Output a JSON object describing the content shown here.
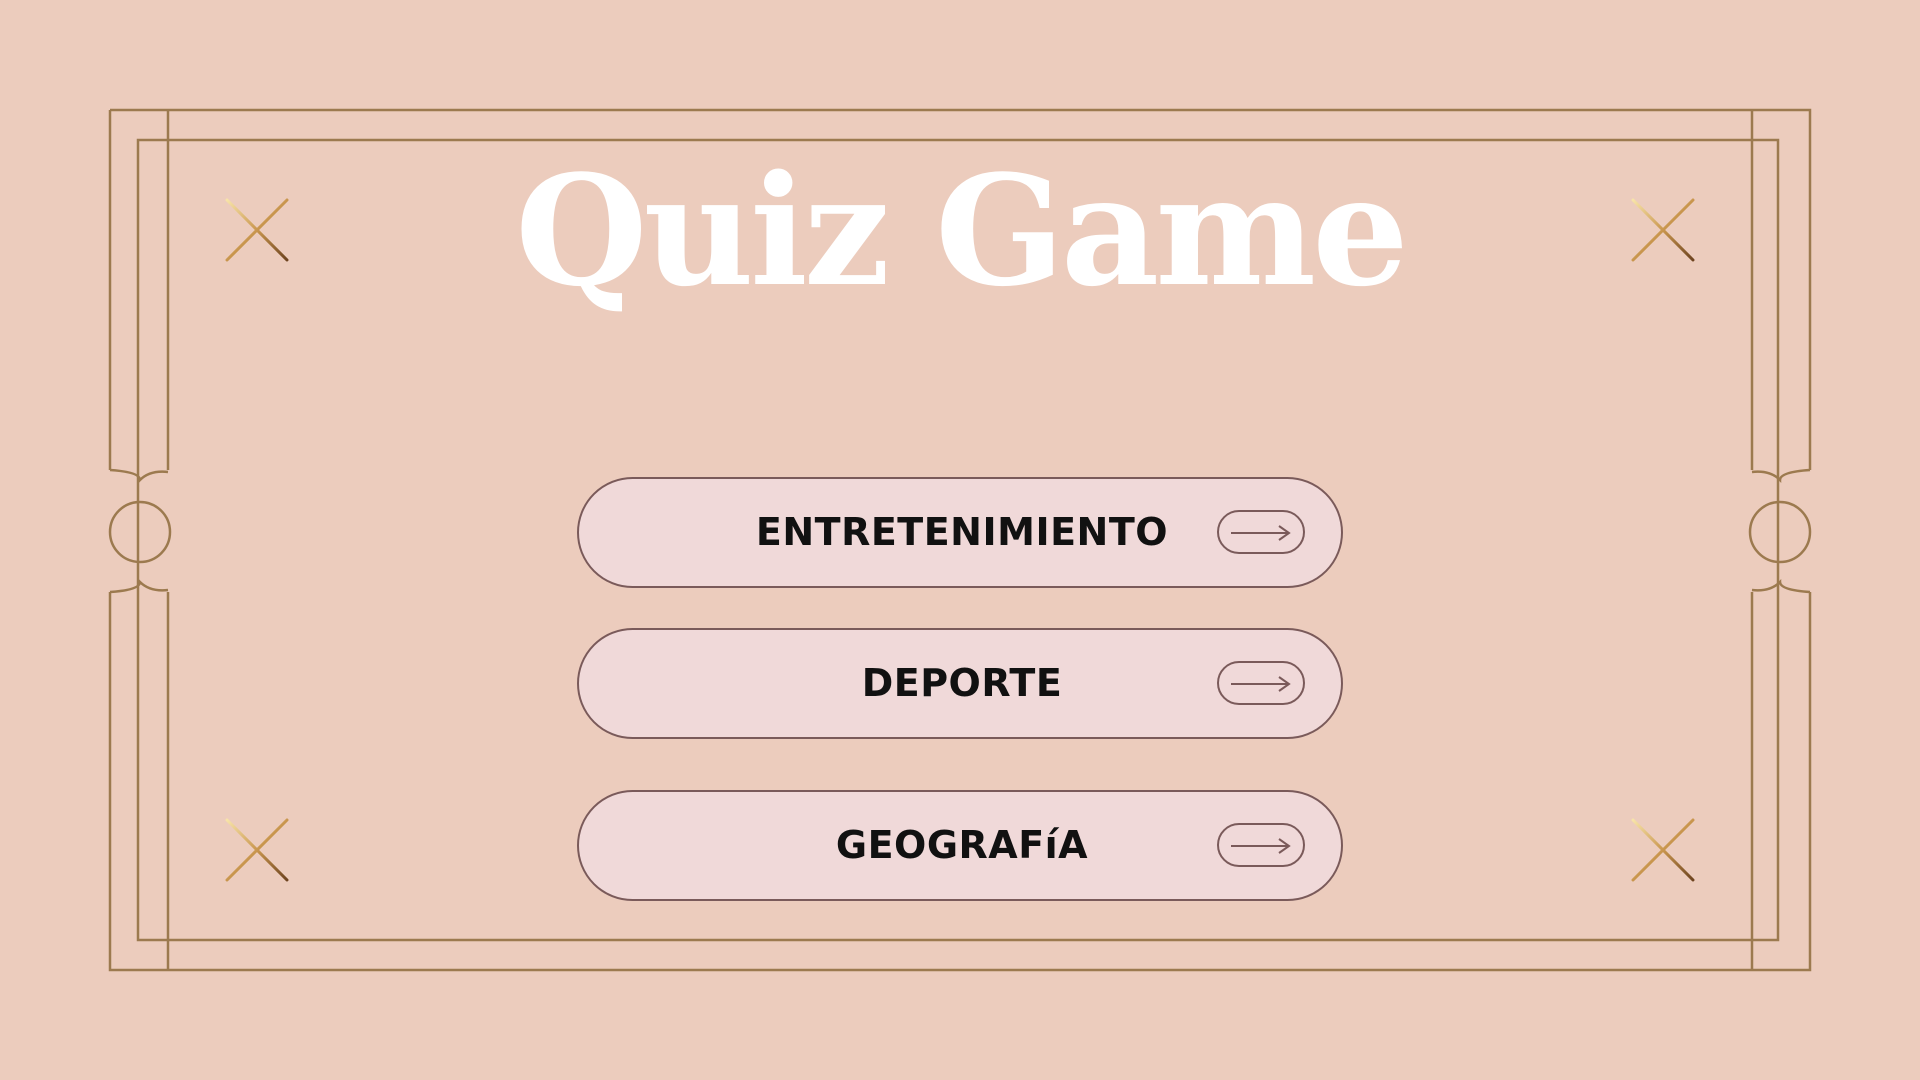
{
  "title": "Quiz Game",
  "categories": [
    {
      "label": "ENTRETENIMIENTO",
      "icon": "arrow-right-icon"
    },
    {
      "label": "DEPORTE",
      "icon": "arrow-right-icon"
    },
    {
      "label": "GEOGRAFíA",
      "icon": "arrow-right-icon"
    }
  ],
  "decorations": {
    "sparkle_icon": "sparkle-star-icon",
    "frame": "art-deco-double-border"
  },
  "colors": {
    "background": "#ecccbd",
    "frame": "#9c7a4f",
    "button_fill": "#f0d9d9",
    "button_border": "#7a5a5a",
    "title": "#ffffff",
    "label": "#111111",
    "sparkle_gold": "#d9b56a"
  }
}
